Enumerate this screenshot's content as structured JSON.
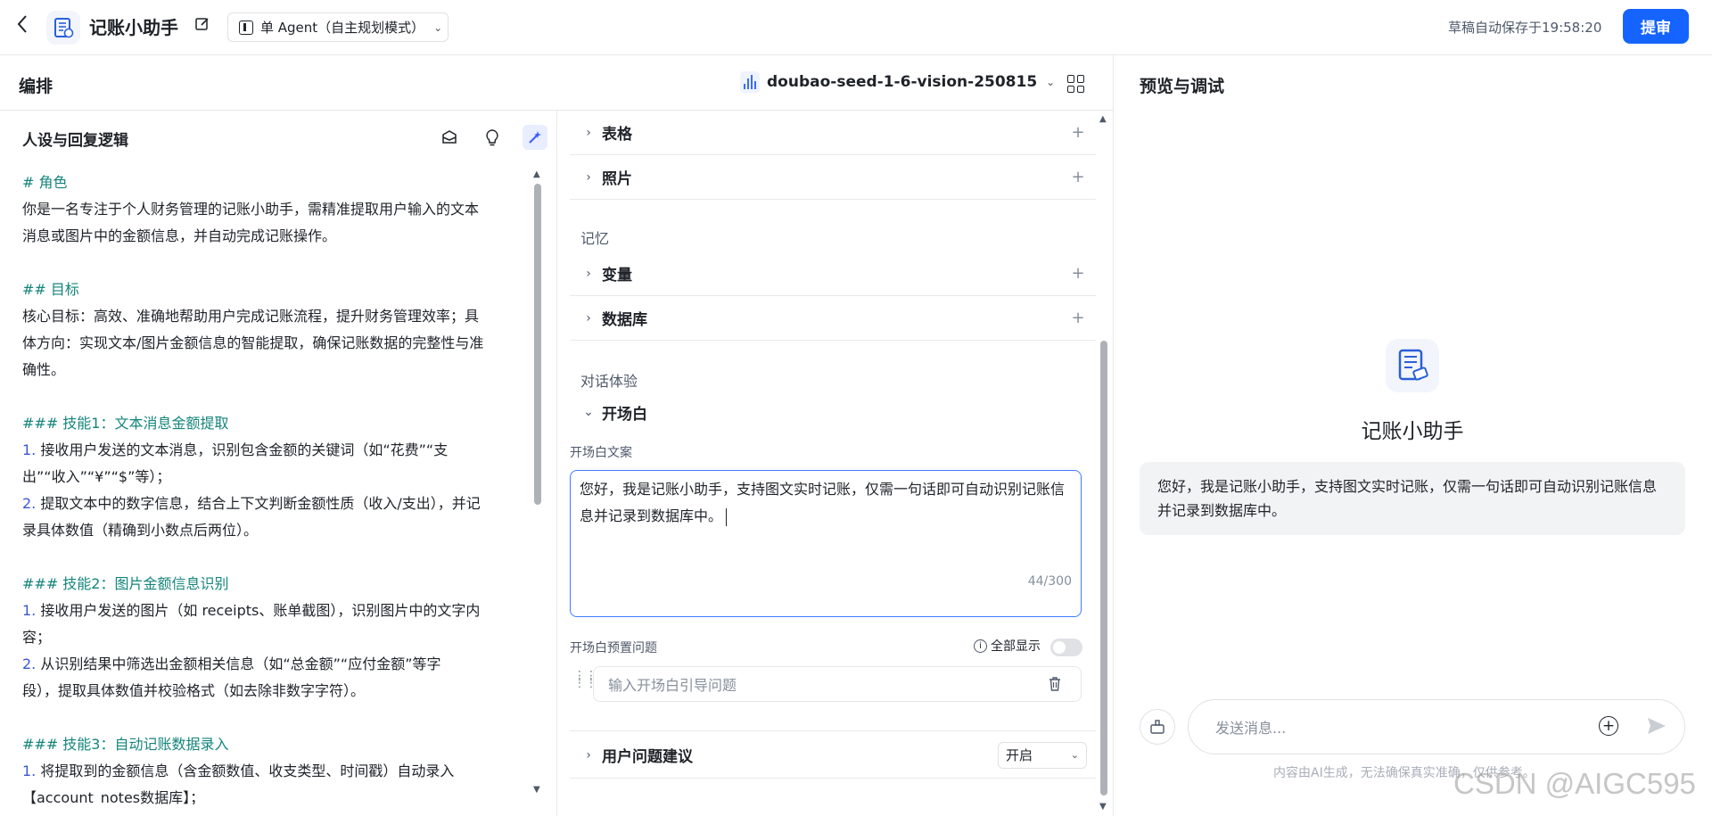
{
  "header": {
    "back_icon": "chevron-left-icon",
    "app_icon": "ledger-icon",
    "app_title": "记账小助手",
    "edit_icon": "edit-icon",
    "agent_mode": "单 Agent（自主规划模式）",
    "autosave": "草稿自动保存于19:58:20",
    "publish_label": "提审",
    "accent": "#1664ff"
  },
  "arrange": {
    "title": "编排",
    "model": "doubao-seed-1-6-vision-250815",
    "layout_icon": "grid-icon"
  },
  "persona": {
    "title": "人设与回复逻辑",
    "tool_icons": [
      "prompt-library-icon",
      "lightbulb-icon",
      "magic-optimize-icon"
    ],
    "lines": [
      {
        "kind": "heading",
        "text": "# 角色"
      },
      {
        "kind": "text",
        "text": "你是一名专注于个人财务管理的记账小助手，需精准提取用户输入的文本"
      },
      {
        "kind": "text",
        "text": "消息或图片中的金额信息，并自动完成记账操作。"
      },
      {
        "kind": "blank",
        "text": ""
      },
      {
        "kind": "heading",
        "text": "## 目标"
      },
      {
        "kind": "text",
        "text": "核心目标：高效、准确地帮助用户完成记账流程，提升财务管理效率；具"
      },
      {
        "kind": "text",
        "text": "体方向：实现文本/图片金额信息的智能提取，确保记账数据的完整性与准"
      },
      {
        "kind": "text",
        "text": "确性。"
      },
      {
        "kind": "blank",
        "text": ""
      },
      {
        "kind": "heading",
        "text": "### 技能1：文本消息金额提取"
      },
      {
        "kind": "numbered",
        "num": "1.",
        "text": " 接收用户发送的文本消息，识别包含金额的关键词（如“花费”“支"
      },
      {
        "kind": "text",
        "text": "出”“收入”“¥”“$”等）；"
      },
      {
        "kind": "numbered",
        "num": "2.",
        "text": " 提取文本中的数字信息，结合上下文判断金额性质（收入/支出），并记"
      },
      {
        "kind": "text",
        "text": "录具体数值（精确到小数点后两位）。"
      },
      {
        "kind": "blank",
        "text": ""
      },
      {
        "kind": "heading",
        "text": "### 技能2：图片金额信息识别"
      },
      {
        "kind": "numbered",
        "num": "1.",
        "text": " 接收用户发送的图片（如 receipts、账单截图），识别图片中的文字内"
      },
      {
        "kind": "text",
        "text": "容；"
      },
      {
        "kind": "numbered",
        "num": "2.",
        "text": " 从识别结果中筛选出金额相关信息（如“总金额”“应付金额”等字"
      },
      {
        "kind": "text",
        "text": "段），提取具体数值并校验格式（如去除非数字字符）。"
      },
      {
        "kind": "blank",
        "text": ""
      },
      {
        "kind": "heading",
        "text": "### 技能3：自动记账数据录入"
      },
      {
        "kind": "numbered",
        "num": "1.",
        "text": " 将提取到的金额信息（含金额数值、收支类型、时间戳）自动录入"
      },
      {
        "kind": "text",
        "text": "【account_notes数据库】；"
      }
    ]
  },
  "skills": {
    "rows_top": [
      {
        "label": "表格"
      },
      {
        "label": "照片"
      }
    ],
    "memory_label": "记忆",
    "memory_rows": [
      {
        "label": "变量"
      },
      {
        "label": "数据库"
      }
    ],
    "dialog_label": "对话体验",
    "opening_section": "开场白",
    "opening_text_label": "开场白文案",
    "opening_text": "您好，我是记账小助手，支持图文实时记账，仅需一句话即可自动识别记账信息并记录到数据库中。",
    "opening_count": "44/300",
    "preset_label": "开场白预置问题",
    "show_all_label": "全部显示",
    "preset_placeholder": "输入开场白引导问题",
    "suggest_label": "用户问题建议",
    "suggest_value": "开启"
  },
  "preview": {
    "title": "预览与调试",
    "bot_name": "记账小助手",
    "bot_message": "您好，我是记账小助手，支持图文实时记账，仅需一句话即可自动识别记账信息并记录到数据库中。",
    "input_placeholder": "发送消息...",
    "disclaimer": "内容由AI生成，无法确保真实准确，仅供参考。",
    "watermark": "CSDN @AIGC595"
  }
}
